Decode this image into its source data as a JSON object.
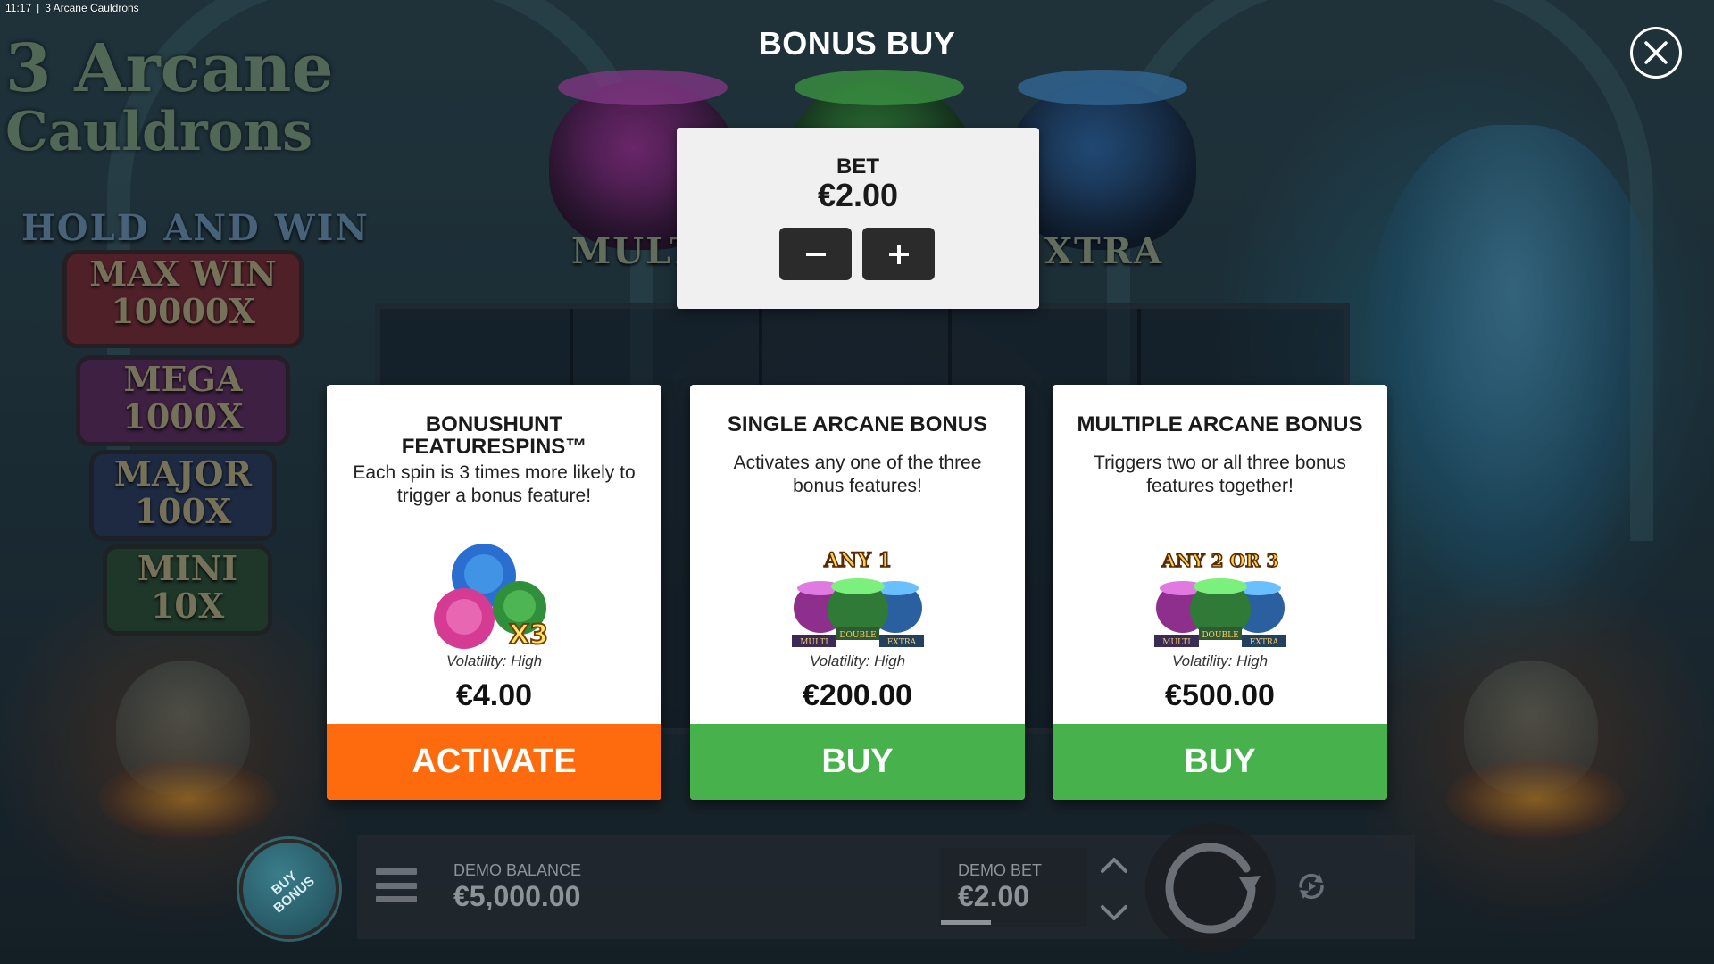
{
  "topbar": {
    "time": "11:17",
    "separator": "|",
    "window_title": "3 Arcane Cauldrons"
  },
  "logo": {
    "line1": "3 Arcane",
    "line2": "Cauldrons",
    "hold_and_win": "HOLD AND WIN"
  },
  "prizes": [
    {
      "label": "MAX WIN",
      "value": "10000X",
      "color": "#8a2f3a"
    },
    {
      "label": "MEGA",
      "value": "1000X",
      "color": "#6a2f6a"
    },
    {
      "label": "MAJOR",
      "value": "100X",
      "color": "#2f3f66"
    },
    {
      "label": "MINI",
      "value": "10X",
      "color": "#2f5a3a"
    }
  ],
  "feature_labels": {
    "left": "MULT",
    "right": "XTRA"
  },
  "modal": {
    "title": "BONUS BUY",
    "close_icon": "close-icon",
    "bet": {
      "label": "BET",
      "value": "€2.00",
      "decrease_icon": "minus-icon",
      "increase_icon": "plus-icon"
    }
  },
  "cards": [
    {
      "title_line1": "BONUSHUNT",
      "title_line2": "FEATURESPINS™",
      "description": "Each spin is 3 times more likely to trigger a bonus feature!",
      "image_badge": "X3",
      "volatility": "Volatility: High",
      "price": "€4.00",
      "action": "ACTIVATE",
      "action_color": "#fd6b0e"
    },
    {
      "title_line1": "SINGLE ARCANE BONUS",
      "title_line2": "",
      "description": "Activates any one of the three bonus features!",
      "image_badge": "ANY 1",
      "image_labels": [
        "MULTI",
        "DOUBLE",
        "EXTRA"
      ],
      "volatility": "Volatility: High",
      "price": "€200.00",
      "action": "BUY",
      "action_color": "#47b24b"
    },
    {
      "title_line1": "MULTIPLE ARCANE BONUS",
      "title_line2": "",
      "description": "Triggers two or all three bonus features together!",
      "image_badge": "ANY 2 OR 3",
      "image_labels": [
        "MULTI",
        "DOUBLE",
        "EXTRA"
      ],
      "volatility": "Volatility: High",
      "price": "€500.00",
      "action": "BUY",
      "action_color": "#47b24b"
    }
  ],
  "bottom_bar": {
    "buy_bonus_line1": "BUY",
    "buy_bonus_line2": "BONUS",
    "menu_icon": "hamburger-menu-icon",
    "balance_label": "DEMO BALANCE",
    "balance_value": "€5,000.00",
    "bet_label": "DEMO BET",
    "bet_value": "€2.00",
    "stepper_up_icon": "chevron-up-icon",
    "stepper_down_icon": "chevron-down-icon",
    "spin_icon": "spin-arrow-icon",
    "autoplay_icon": "autoplay-icon"
  }
}
